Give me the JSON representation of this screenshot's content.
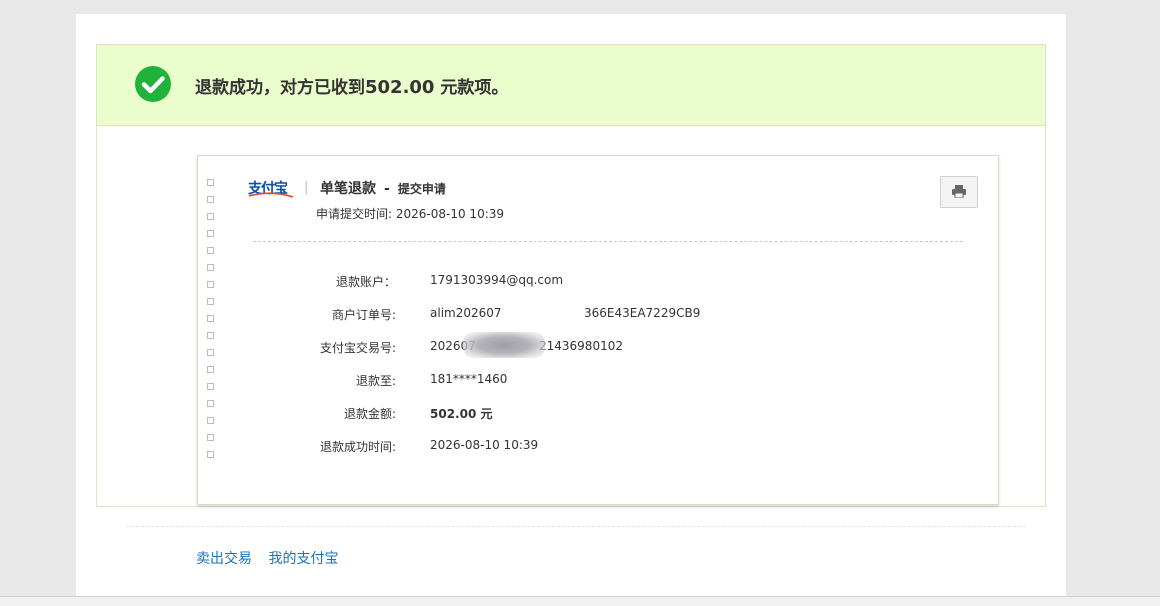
{
  "banner": {
    "text_prefix": "退款成功，对方已收到",
    "amount": "502.00",
    "text_suffix": " 元款项。"
  },
  "receipt": {
    "logo_text": "支付宝",
    "title": "单笔退款",
    "dash": "-",
    "subtitle": "提交申请",
    "apply_time_label": "申请提交时间:",
    "apply_time": "2026-08-10 10:39",
    "print_icon": "printer-icon",
    "rows": [
      {
        "label": "退款账户：",
        "value": "1791303994@qq.com"
      },
      {
        "label": "商户订单号:",
        "value_left": "alim202607",
        "value_right": "366E43EA7229CB9"
      },
      {
        "label": "支付宝交易号:",
        "value_left": "202607",
        "value_right": "21436980102"
      },
      {
        "label": "退款至:",
        "value": "181****1460"
      },
      {
        "label": "退款金额:",
        "value": "502.00 元"
      },
      {
        "label": "退款成功时间:",
        "value": "2026-08-10 10:39"
      }
    ]
  },
  "footer_links": {
    "sold": "卖出交易",
    "my_alipay": "我的支付宝"
  },
  "colors": {
    "banner_bg": "#ebfdcd",
    "success_green": "#20b23b",
    "link_blue": "#1c73b9"
  }
}
